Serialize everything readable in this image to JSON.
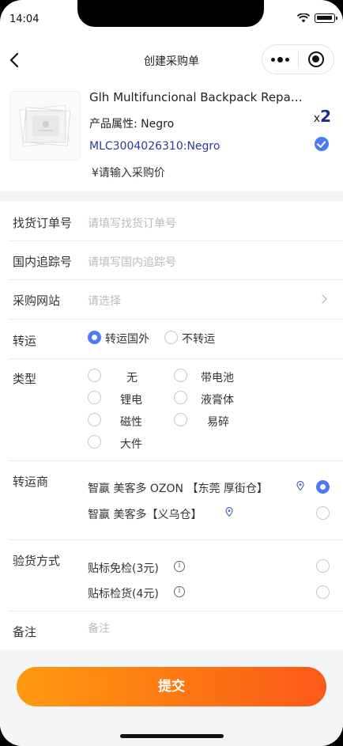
{
  "status": {
    "time": "14:04"
  },
  "nav": {
    "title": "创建采购单"
  },
  "product": {
    "name": "Glh Multifuncional Backpack Reparti…",
    "attr_label": "产品属性:",
    "attr_value": "Negro",
    "sku": "MLC3004026310:Negro",
    "price": "¥请输入采购价",
    "qty_prefix": "x",
    "qty": "2",
    "selected": true
  },
  "form": {
    "order_no": {
      "label": "找货订单号",
      "placeholder": "请填写找货订单号"
    },
    "tracking_no": {
      "label": "国内追踪号",
      "placeholder": "请填写国内追踪号"
    },
    "site": {
      "label": "采购网站",
      "placeholder": "请选择"
    },
    "transit": {
      "label": "转运",
      "options": [
        {
          "label": "转运国外",
          "selected": true
        },
        {
          "label": "不转运",
          "selected": false
        }
      ]
    },
    "type": {
      "label": "类型",
      "options": [
        {
          "label": "无",
          "selected": false
        },
        {
          "label": "带电池",
          "selected": false
        },
        {
          "label": "锂电",
          "selected": false
        },
        {
          "label": "液膏体",
          "selected": false
        },
        {
          "label": "磁性",
          "selected": false
        },
        {
          "label": "易碎",
          "selected": false
        },
        {
          "label": "大件",
          "selected": false
        }
      ]
    },
    "forwarder": {
      "label": "转运商",
      "options": [
        {
          "label": "智赢 美客多 OZON 【东莞 厚街仓】",
          "selected": true
        },
        {
          "label": "智赢 美客多【义乌仓】",
          "selected": false
        }
      ]
    },
    "inspection": {
      "label": "验货方式",
      "options": [
        {
          "label": "贴标免检(3元)",
          "selected": false
        },
        {
          "label": "贴标检货(4元)",
          "selected": false
        }
      ]
    },
    "remark": {
      "label": "备注",
      "placeholder": "备注"
    }
  },
  "submit": {
    "label": "提交"
  },
  "colors": {
    "accent_blue": "#4a7cf0",
    "sku_blue": "#2f3a9a",
    "button_start": "#ff9a10",
    "button_end": "#fb5a18"
  }
}
